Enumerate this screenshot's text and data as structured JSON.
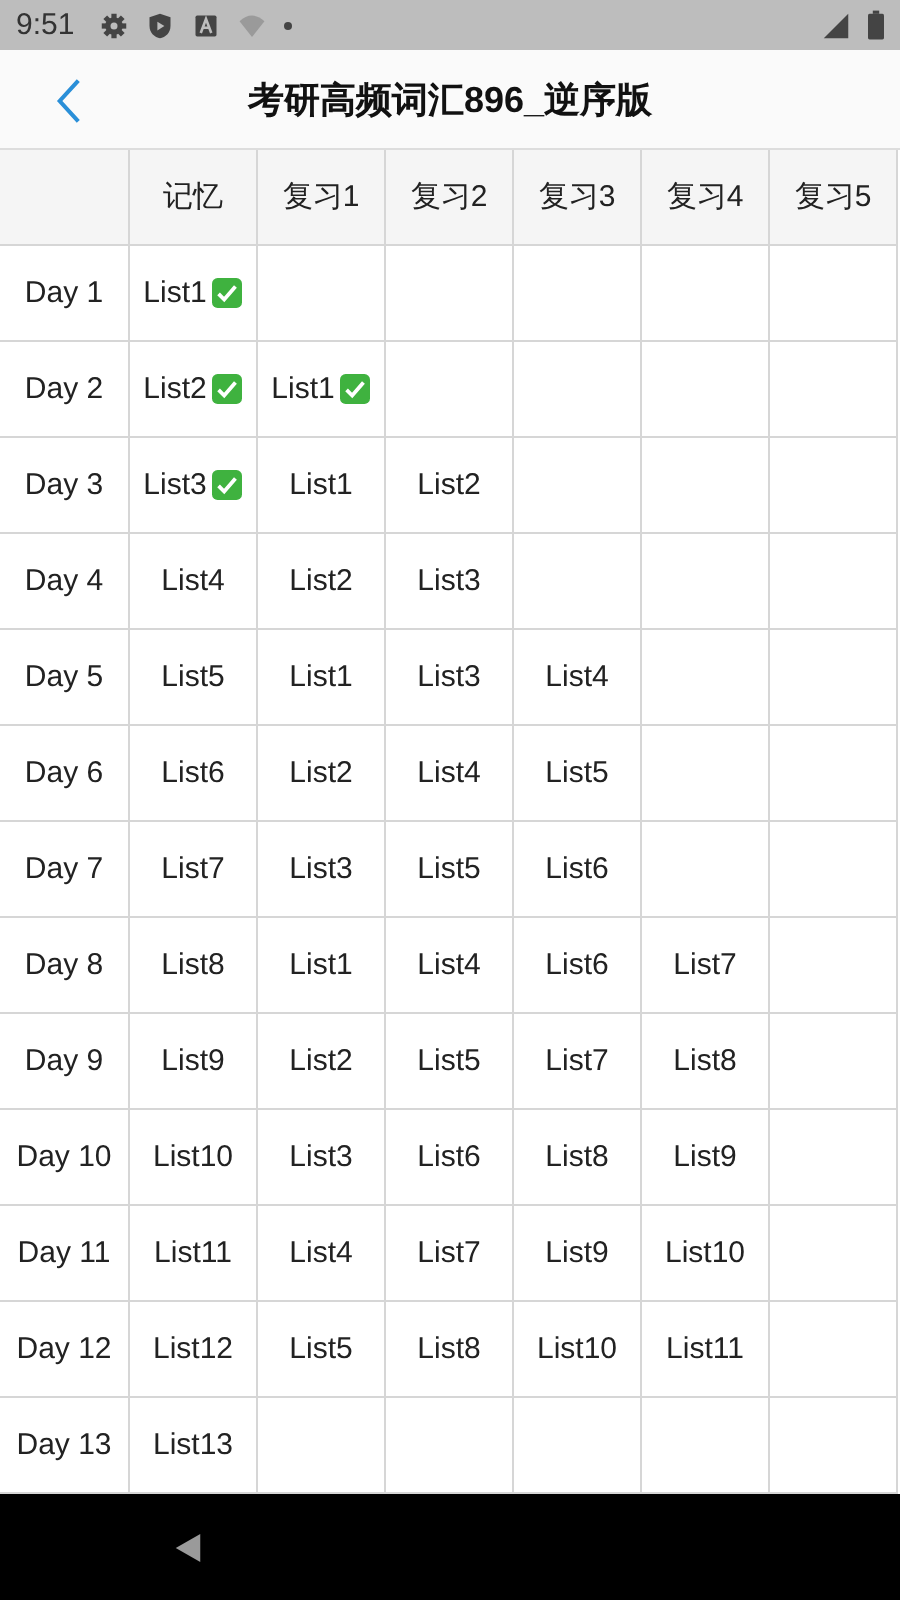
{
  "status_bar": {
    "time": "9:51"
  },
  "header": {
    "title": "考研高频词汇896_逆序版"
  },
  "table": {
    "columns": [
      "记忆",
      "复习1",
      "复习2",
      "复习3",
      "复习4",
      "复习5"
    ],
    "rows": [
      {
        "day": "Day 1",
        "cells": [
          {
            "text": "List1",
            "done": true
          }
        ]
      },
      {
        "day": "Day 2",
        "cells": [
          {
            "text": "List2",
            "done": true
          },
          {
            "text": "List1",
            "done": true
          }
        ]
      },
      {
        "day": "Day 3",
        "cells": [
          {
            "text": "List3",
            "done": true
          },
          {
            "text": "List1",
            "done": false
          },
          {
            "text": "List2",
            "done": false
          }
        ]
      },
      {
        "day": "Day 4",
        "cells": [
          {
            "text": "List4",
            "done": false
          },
          {
            "text": "List2",
            "done": false
          },
          {
            "text": "List3",
            "done": false
          }
        ]
      },
      {
        "day": "Day 5",
        "cells": [
          {
            "text": "List5",
            "done": false
          },
          {
            "text": "List1",
            "done": false
          },
          {
            "text": "List3",
            "done": false
          },
          {
            "text": "List4",
            "done": false
          }
        ]
      },
      {
        "day": "Day 6",
        "cells": [
          {
            "text": "List6",
            "done": false
          },
          {
            "text": "List2",
            "done": false
          },
          {
            "text": "List4",
            "done": false
          },
          {
            "text": "List5",
            "done": false
          }
        ]
      },
      {
        "day": "Day 7",
        "cells": [
          {
            "text": "List7",
            "done": false
          },
          {
            "text": "List3",
            "done": false
          },
          {
            "text": "List5",
            "done": false
          },
          {
            "text": "List6",
            "done": false
          }
        ]
      },
      {
        "day": "Day 8",
        "cells": [
          {
            "text": "List8",
            "done": false
          },
          {
            "text": "List1",
            "done": false
          },
          {
            "text": "List4",
            "done": false
          },
          {
            "text": "List6",
            "done": false
          },
          {
            "text": "List7",
            "done": false
          }
        ]
      },
      {
        "day": "Day 9",
        "cells": [
          {
            "text": "List9",
            "done": false
          },
          {
            "text": "List2",
            "done": false
          },
          {
            "text": "List5",
            "done": false
          },
          {
            "text": "List7",
            "done": false
          },
          {
            "text": "List8",
            "done": false
          }
        ]
      },
      {
        "day": "Day 10",
        "cells": [
          {
            "text": "List10",
            "done": false
          },
          {
            "text": "List3",
            "done": false
          },
          {
            "text": "List6",
            "done": false
          },
          {
            "text": "List8",
            "done": false
          },
          {
            "text": "List9",
            "done": false
          }
        ]
      },
      {
        "day": "Day 11",
        "cells": [
          {
            "text": "List11",
            "done": false
          },
          {
            "text": "List4",
            "done": false
          },
          {
            "text": "List7",
            "done": false
          },
          {
            "text": "List9",
            "done": false
          },
          {
            "text": "List10",
            "done": false
          }
        ]
      },
      {
        "day": "Day 12",
        "cells": [
          {
            "text": "List12",
            "done": false
          },
          {
            "text": "List5",
            "done": false
          },
          {
            "text": "List8",
            "done": false
          },
          {
            "text": "List10",
            "done": false
          },
          {
            "text": "List11",
            "done": false
          }
        ]
      },
      {
        "day": "Day 13",
        "cells": [
          {
            "text": "List13",
            "done": false
          }
        ]
      }
    ]
  }
}
